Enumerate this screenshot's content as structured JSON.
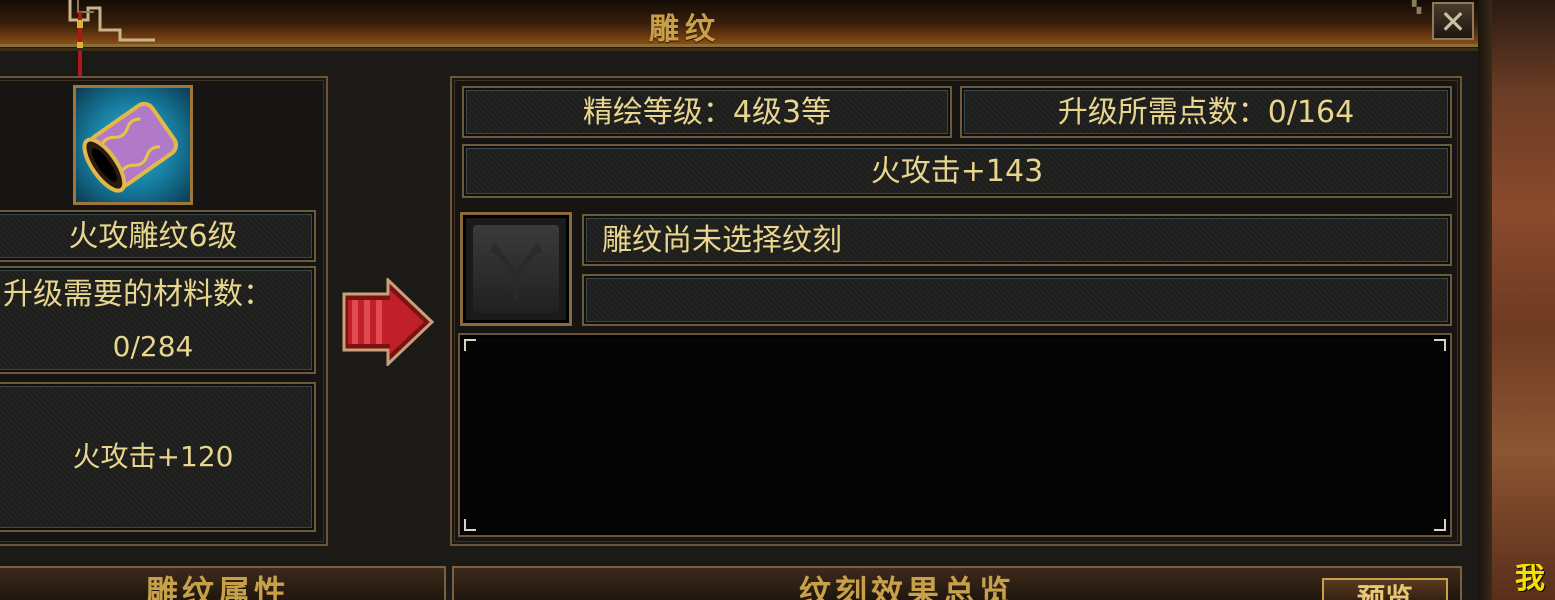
{
  "window": {
    "title": "雕纹",
    "close_label": "✕"
  },
  "left_panel": {
    "item_icon": "purple-gold-cuff-icon",
    "item_name": "火攻雕纹6级",
    "materials_label": "升级需要的材料数：",
    "materials_count": "0/284",
    "current_effect": "火攻击+120"
  },
  "right_panel": {
    "refine_level": "精绘等级：4级3等",
    "upgrade_points": "升级所需点数：0/164",
    "next_effect": "火攻击+143",
    "engrave_status": "雕纹尚未选择纹刻",
    "engrave_sub": "",
    "description": ""
  },
  "bottom": {
    "left_tab": "雕纹属性",
    "right_tab": "纹刻效果总览",
    "preview_button": "预览"
  },
  "world": {
    "text": "我"
  },
  "colors": {
    "gold_text": "#e8d58e",
    "frame": "#6b5536",
    "title_gold": "#c8a04a",
    "arrow_red": "#c0202a"
  }
}
